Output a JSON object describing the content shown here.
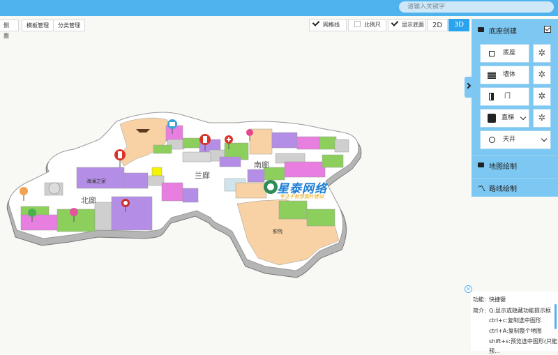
{
  "search": {
    "placeholder": "请输入关键字"
  },
  "toolbar": {
    "side_view_label": "侧面",
    "template_manage_label": "模板管理",
    "category_manage_label": "分类管理"
  },
  "view_options": {
    "grid_label": "网格线",
    "grid_checked": true,
    "scale_label": "比例尺",
    "scale_checked": false,
    "show_base_label": "显示底面",
    "show_base_checked": true,
    "mode_2d_label": "2D",
    "mode_3d_label": "3D",
    "active_mode": "3D"
  },
  "panel": {
    "base_section_title": "底座创建",
    "base_section_checked": true,
    "items": [
      {
        "label": "底座",
        "icon": "square-icon"
      },
      {
        "label": "墙体",
        "icon": "wall-icon"
      },
      {
        "label": "门",
        "icon": "door-icon"
      },
      {
        "label": "直梯",
        "icon": "elevator-icon"
      },
      {
        "label": "天井",
        "icon": "circle-icon"
      }
    ],
    "map_section_title": "地图绘制",
    "route_section_title": "路线绘制"
  },
  "map_labels": {
    "north_corridor": "北廊",
    "south_corridor": "南廊",
    "lan_corridor": "兰廊",
    "shop_name": "海澜之家",
    "cinema": "影院"
  },
  "watermark": {
    "title": "星泰网络",
    "subtitle": "专注于智慧图片建设"
  },
  "info_panel": {
    "function_label": "功能:",
    "function_value": "快捷键",
    "intro_label": "简介:",
    "lines": [
      "Q:显示或隐藏功能提示框",
      "ctrl+c:复制选中图形",
      "ctrl+A:复制整个地图",
      "shift+s:预览选中图形(只能",
      "预..."
    ]
  },
  "colors": {
    "topbar": "#4fb3ee",
    "active_tab": "#2aa4ec",
    "panel_bg": "#7dc8f2",
    "map_floor": "#ffffff",
    "map_wall": "#b5b5b5",
    "zone_purple": "#b48ee6",
    "zone_pink": "#e87ee0",
    "zone_green": "#8ccf5c",
    "zone_peach": "#f8d2a4",
    "zone_gray": "#cfcfcf"
  }
}
